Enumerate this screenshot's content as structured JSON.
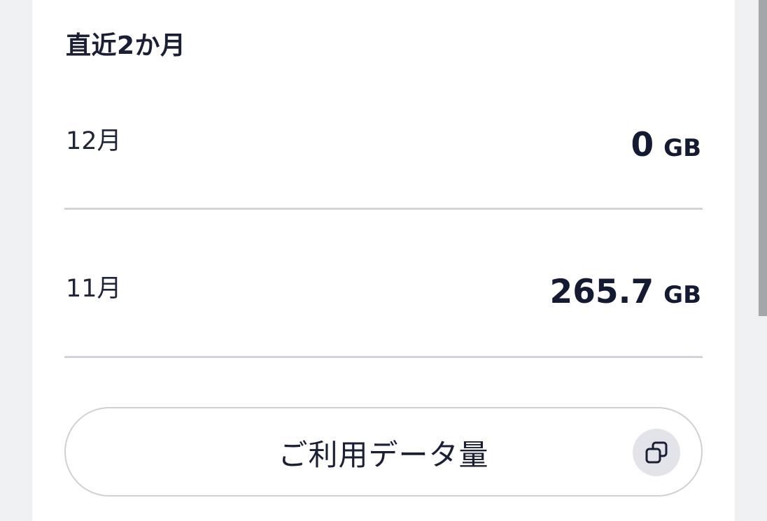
{
  "section": {
    "title": "直近2か月"
  },
  "usage_rows": [
    {
      "month": "12月",
      "value": "0",
      "unit": "GB"
    },
    {
      "month": "11月",
      "value": "265.7",
      "unit": "GB"
    }
  ],
  "data_button": {
    "label": "ご利用データ量",
    "icon": "copy-icon"
  },
  "colors": {
    "text": "#1a1f36",
    "divider": "#d3d4d9",
    "background": "#eff0f2",
    "card": "#ffffff",
    "icon_bg": "#e3e4e9"
  }
}
